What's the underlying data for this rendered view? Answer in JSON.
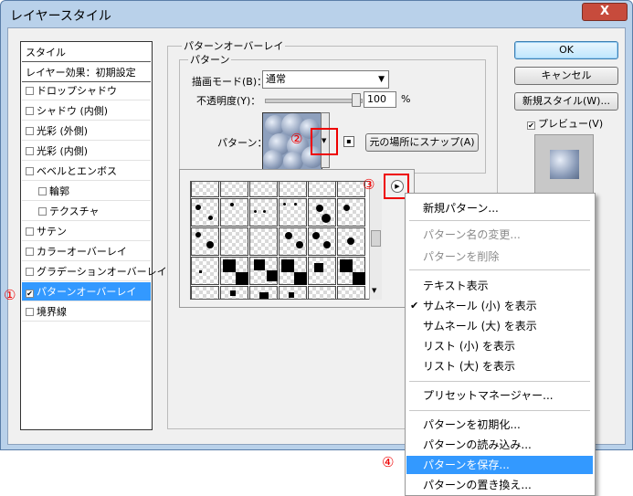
{
  "window": {
    "title": "レイヤースタイル",
    "close_label": "X"
  },
  "style_list": {
    "header": "スタイル",
    "blend_options": "レイヤー効果：初期設定",
    "items": [
      {
        "label": "ドロップシャドウ",
        "checked": false
      },
      {
        "label": "シャドウ (内側)",
        "checked": false
      },
      {
        "label": "光彩 (外側)",
        "checked": false
      },
      {
        "label": "光彩 (内側)",
        "checked": false
      },
      {
        "label": "ベベルとエンボス",
        "checked": false
      },
      {
        "label": "輪郭",
        "checked": false
      },
      {
        "label": "テクスチャ",
        "checked": false
      },
      {
        "label": "サテン",
        "checked": false
      },
      {
        "label": "カラーオーバーレイ",
        "checked": false
      },
      {
        "label": "グラデーションオーバーレイ",
        "checked": false
      },
      {
        "label": "パターンオーバーレイ",
        "checked": true
      },
      {
        "label": "境界線",
        "checked": false
      }
    ]
  },
  "panel": {
    "group_title": "パターンオーバーレイ",
    "sub_title": "パターン",
    "blend_mode_label": "描画モード(B)：",
    "blend_mode_value": "通常",
    "opacity_label": "不透明度(Y)：",
    "opacity_value": "100",
    "opacity_unit": "%",
    "pattern_label": "パターン：",
    "snap_button": "元の場所にスナップ(A)"
  },
  "buttons": {
    "ok": "OK",
    "cancel": "キャンセル",
    "new_style": "新規スタイル(W)...",
    "preview_label": "プレビュー(V)",
    "preview_checked": true
  },
  "markers": {
    "m1": "①",
    "m2": "②",
    "m3": "③",
    "m4": "④"
  },
  "menu": {
    "items": [
      {
        "label": "新規パターン...",
        "disabled": false
      },
      {
        "label": "パターン名の変更...",
        "disabled": true
      },
      {
        "label": "パターンを削除",
        "disabled": true
      },
      {
        "label": "テキスト表示",
        "disabled": false
      },
      {
        "label": "サムネール (小) を表示",
        "disabled": false,
        "checked": true
      },
      {
        "label": "サムネール (大) を表示",
        "disabled": false
      },
      {
        "label": "リスト (小) を表示",
        "disabled": false
      },
      {
        "label": "リスト (大) を表示",
        "disabled": false
      },
      {
        "label": "プリセットマネージャー...",
        "disabled": false
      },
      {
        "label": "パターンを初期化...",
        "disabled": false
      },
      {
        "label": "パターンの読み込み...",
        "disabled": false
      },
      {
        "label": "パターンを保存...",
        "disabled": false,
        "highlighted": true
      },
      {
        "label": "パターンの置き換え...",
        "disabled": false
      }
    ],
    "check_glyph": "✔"
  },
  "colors": {
    "accent": "#3399ff",
    "marker": "#ee0000",
    "title_bar": "#b9d1ea"
  }
}
